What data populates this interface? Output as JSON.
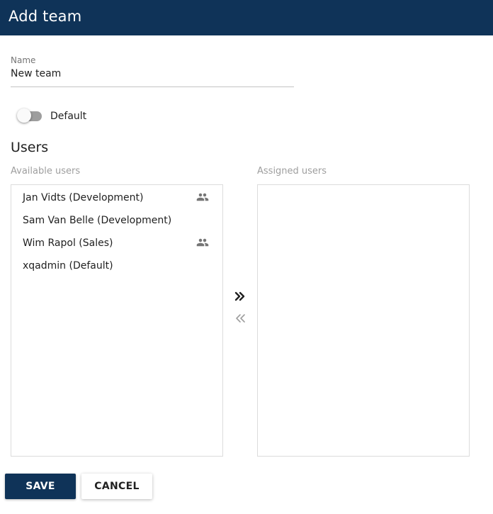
{
  "header": {
    "title": "Add team"
  },
  "form": {
    "name_label": "Name",
    "name_value": "New team",
    "default_toggle": {
      "label": "Default",
      "checked": false
    }
  },
  "users": {
    "title": "Users",
    "available_label": "Available users",
    "assigned_label": "Assigned users",
    "available": [
      {
        "name": "Jan Vidts (Development)",
        "icon": "group-icon"
      },
      {
        "name": "Sam Van Belle (Development)",
        "icon": ""
      },
      {
        "name": "Wim Rapol (Sales)",
        "icon": "group-icon"
      },
      {
        "name": "xqadmin (Default)",
        "icon": ""
      }
    ],
    "assigned": []
  },
  "actions": {
    "save": "SAVE",
    "cancel": "CANCEL"
  },
  "colors": {
    "header_bg": "#0f3358",
    "primary": "#0f3358"
  }
}
